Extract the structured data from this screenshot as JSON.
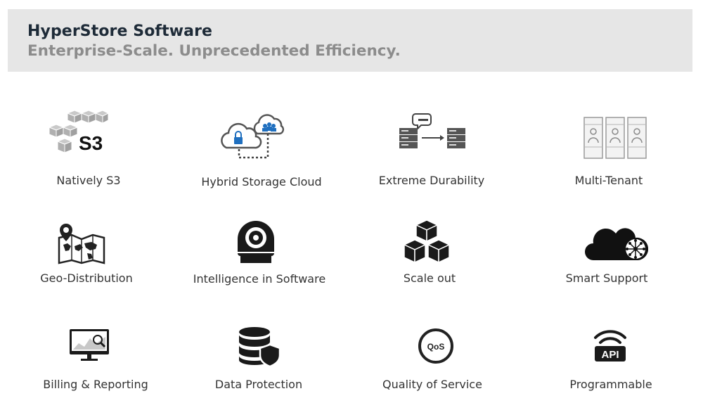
{
  "header": {
    "title": "HyperStore Software",
    "subtitle": "Enterprise-Scale. Unprecedented Efficiency."
  },
  "features": [
    {
      "label": "Natively S3",
      "icon": "s3-cubes-icon"
    },
    {
      "label": "Hybrid Storage Cloud",
      "icon": "hybrid-cloud-icon"
    },
    {
      "label": "Extreme Durability",
      "icon": "server-replication-icon"
    },
    {
      "label": "Multi-Tenant",
      "icon": "multi-tenant-icon"
    },
    {
      "label": "Geo-Distribution",
      "icon": "world-map-pin-icon"
    },
    {
      "label": "Intelligence in Software",
      "icon": "vault-icon"
    },
    {
      "label": "Scale out",
      "icon": "stacked-cubes-icon"
    },
    {
      "label": "Smart Support",
      "icon": "cloud-support-icon"
    },
    {
      "label": "Billing & Reporting",
      "icon": "monitor-chart-icon"
    },
    {
      "label": "Data Protection",
      "icon": "database-shield-icon"
    },
    {
      "label": "Quality of Service",
      "icon": "qos-icon"
    },
    {
      "label": "Programmable",
      "icon": "api-wifi-icon"
    }
  ],
  "icon_text": {
    "s3": "S3",
    "qos": "QoS",
    "api": "API"
  },
  "colors": {
    "header_bg": "#e6e6e6",
    "title": "#1e2b38",
    "subtitle": "#8c8c8c",
    "icon_dark": "#111111",
    "icon_grey": "#999999"
  }
}
